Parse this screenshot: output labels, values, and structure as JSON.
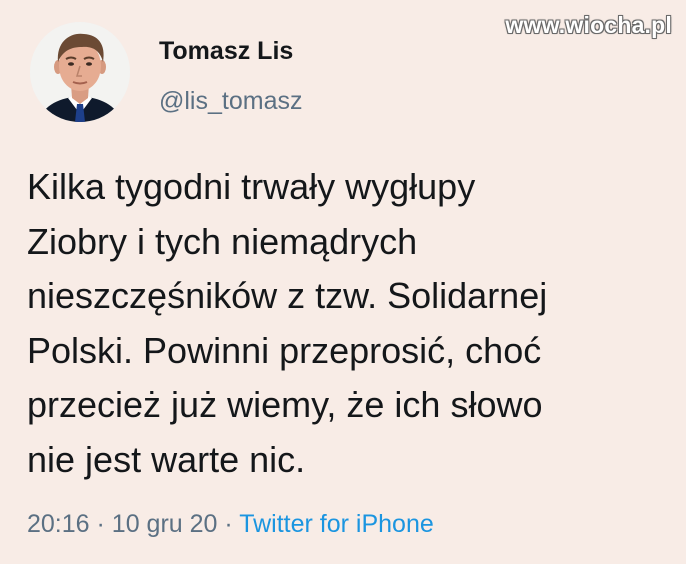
{
  "tweet": {
    "display_name": "Tomasz Lis",
    "handle": "@lis_tomasz",
    "text": "Kilka tygodni trwały wygłupy\nZiobry i tych niemądrych\nnieszczęśników z tzw. Solidarnej\nPolski. Powinni przeprosić, choć\nprzecież już wiemy, że  ich słowo\nnie jest warte nic.",
    "time": "20:16",
    "separator": "·",
    "date": "10 gru 20",
    "source": "Twitter for iPhone"
  },
  "watermark": "www.wiocha.pl",
  "colors": {
    "background": "#f8ece6",
    "text": "#14171a",
    "secondary_text": "#5b7083",
    "link": "#1b95e0"
  },
  "icons": {
    "avatar": "profile-photo"
  }
}
